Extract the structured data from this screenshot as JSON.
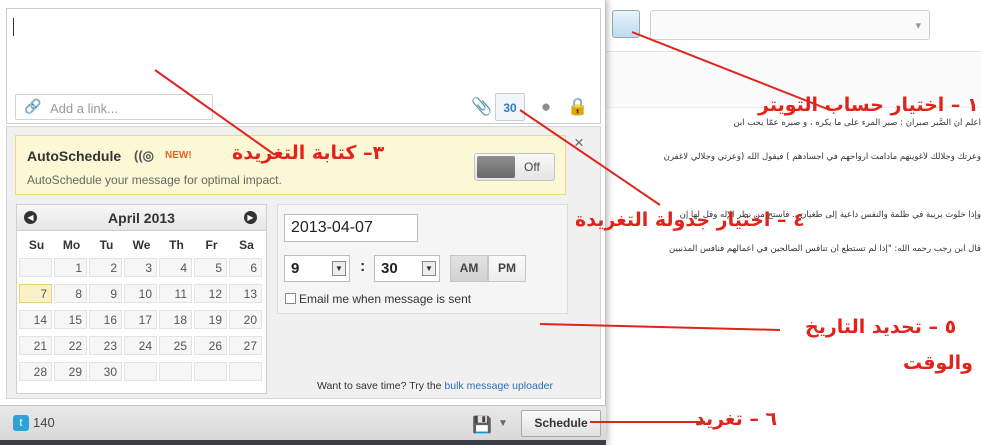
{
  "background_app": {
    "account_selector": {
      "value": "",
      "arrow": "▾"
    },
    "text_lines": [
      "اعلم أن الصَّبر صبران : صبر المرء على ما يكره ، و صبره عمّا يحب ابن",
      "وعزتك وجلالك لأغوينهم مادامت ارواحهم في اجسادهم ) فيقول الله (وعزتي وجلالي لاغفرن",
      "وإذا خلوت بريبة في ظلمة والنفس داعية إلى طغيان .. فاستح من نظر الإله وقل لها إن",
      "قال ابن رجب رحمه الله: \"إذا لم تستطع أن تنافس الصالحين في أعمالهم فنافس المذنبين"
    ]
  },
  "composer": {
    "message_text": "",
    "link_placeholder": "Add a link...",
    "calendar_tool_label": "30"
  },
  "autoschedule": {
    "title": "AutoSchedule",
    "logo": "((◎",
    "badge": "NEW!",
    "description": "AutoSchedule your message for optimal impact.",
    "toggle_label": "Off",
    "close": "×"
  },
  "calendar": {
    "month_title": "April 2013",
    "prev": "◀",
    "next": "▶",
    "weekdays": [
      "Su",
      "Mo",
      "Tu",
      "We",
      "Th",
      "Fr",
      "Sa"
    ],
    "weeks": [
      [
        "",
        "1",
        "2",
        "3",
        "4",
        "5",
        "6"
      ],
      [
        "7",
        "8",
        "9",
        "10",
        "11",
        "12",
        "13"
      ],
      [
        "14",
        "15",
        "16",
        "17",
        "18",
        "19",
        "20"
      ],
      [
        "21",
        "22",
        "23",
        "24",
        "25",
        "26",
        "27"
      ],
      [
        "28",
        "29",
        "30",
        "",
        "",
        "",
        ""
      ]
    ],
    "selected_day": "7"
  },
  "datetime": {
    "date": "2013-04-07",
    "hour": "9",
    "minute": "30",
    "colon": ":",
    "am": "AM",
    "pm": "PM",
    "email_label": "Email me when message is sent"
  },
  "bulk": {
    "prefix": "Want to save time? Try the ",
    "link": "bulk message uploader"
  },
  "footer": {
    "char_count": "140",
    "schedule_label": "Schedule"
  },
  "annotations": {
    "step1": "١ – اختيار حساب التويتر",
    "step3": "٣– كتابة التغريدة",
    "step4": "٤ – اختيار جدولة التغريدة",
    "step5_line1": "٥ – تحديد التاريخ",
    "step5_line2": "والوقت",
    "step6": "٦ – تغريد"
  },
  "colors": {
    "annotation_red": "#e0241b",
    "autoschedule_bg": "#fcf7d5",
    "link_blue": "#2b6fb8",
    "twitter_blue": "#2fa1d9"
  }
}
